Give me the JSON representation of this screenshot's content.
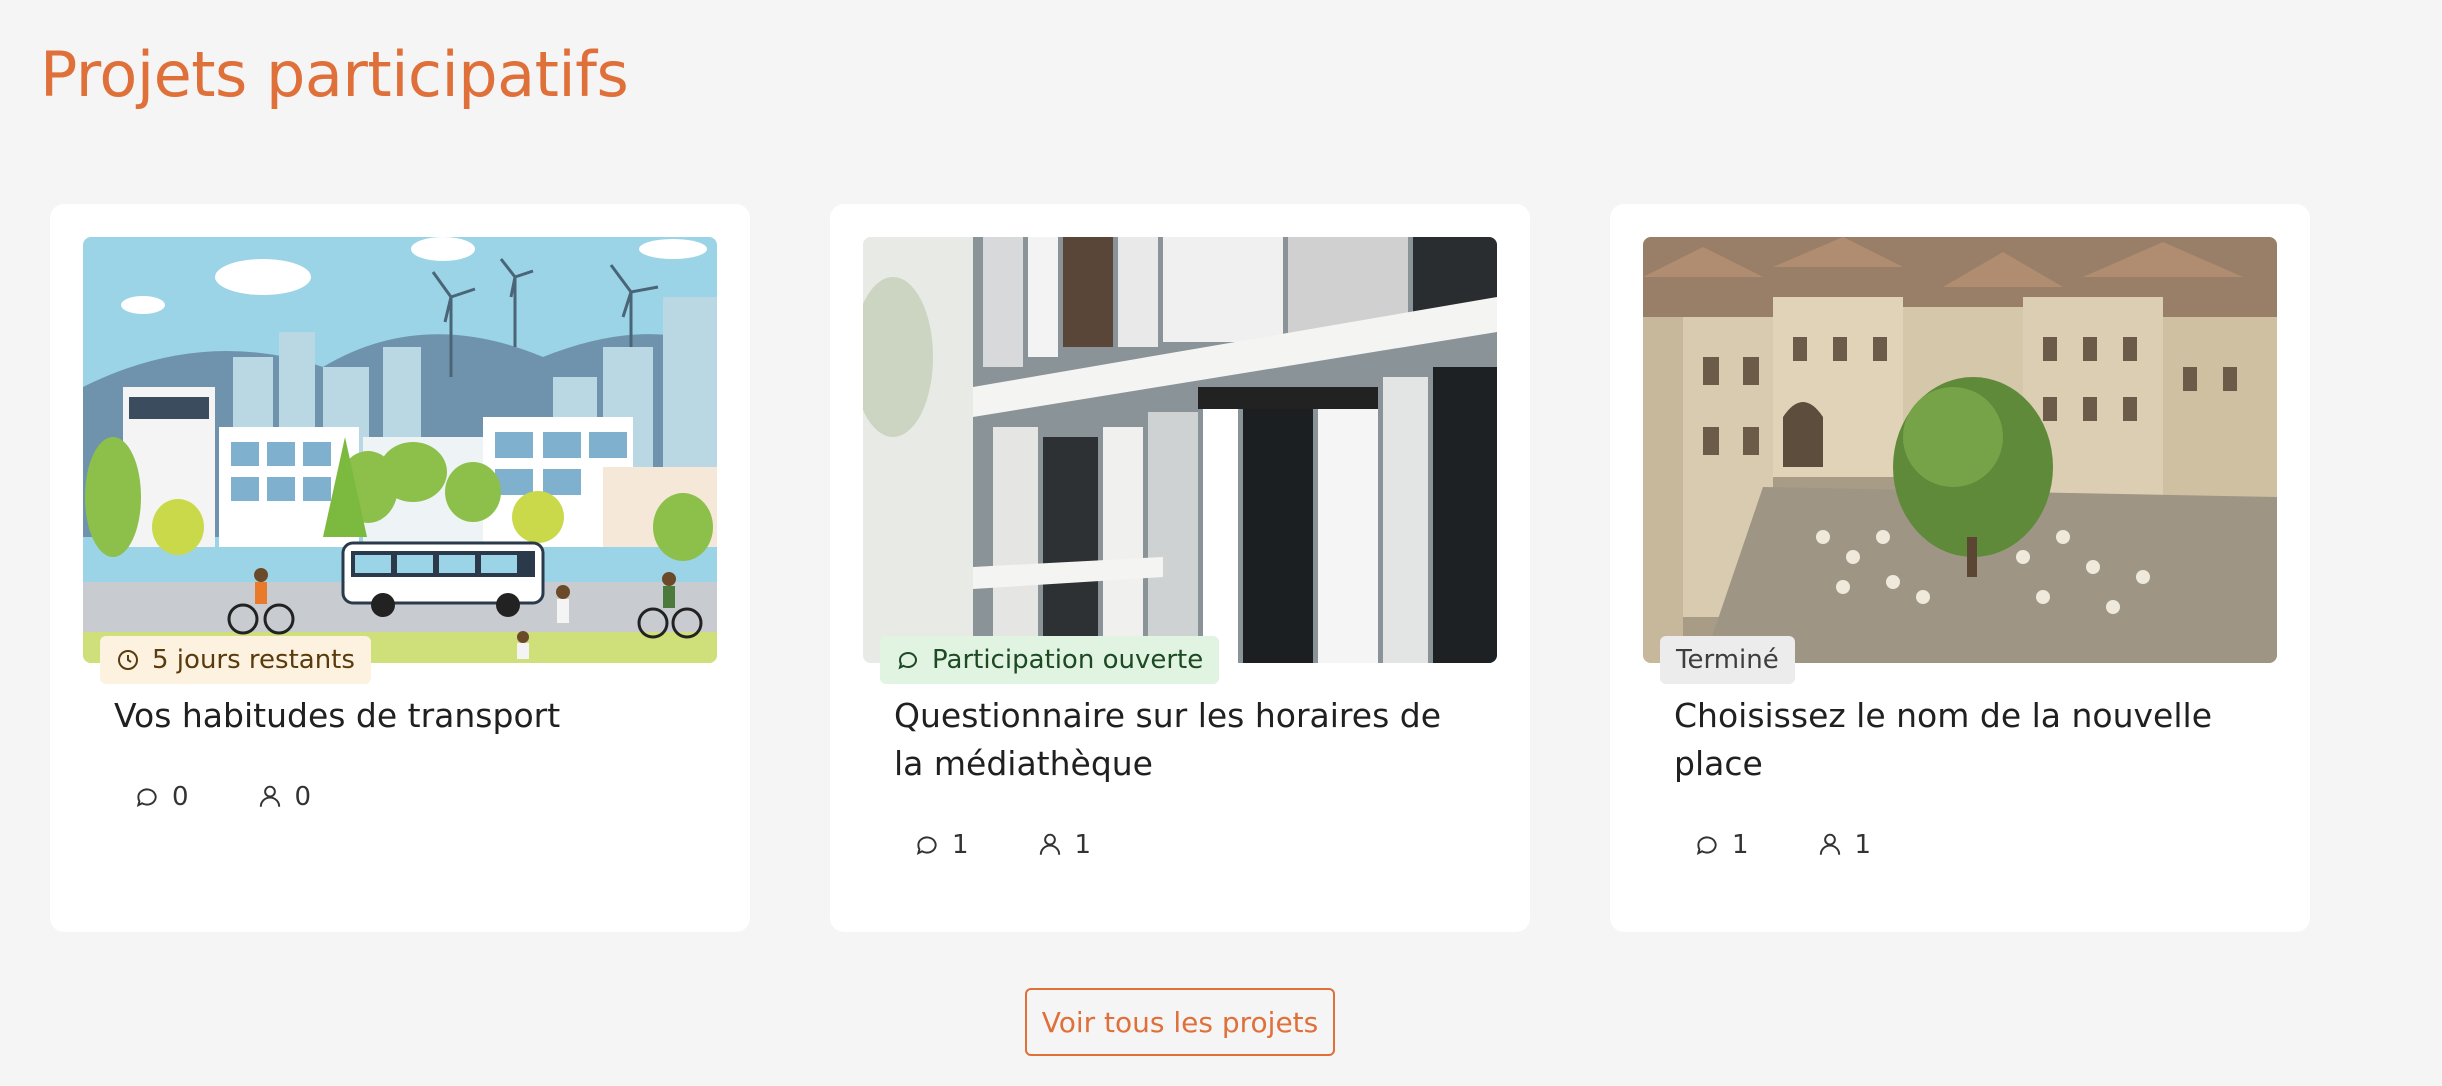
{
  "header": {
    "title": "Projets participatifs"
  },
  "colors": {
    "accent": "#e0703a",
    "badge_warn_bg": "#fdf2df",
    "badge_open_bg": "#e1f4e1",
    "badge_done_bg": "#ececec"
  },
  "projects": [
    {
      "title": "Vos habitudes de transport",
      "badge": {
        "label": "5 jours restants",
        "icon": "clock-icon"
      },
      "comments": "0",
      "participants": "0"
    },
    {
      "title": "Questionnaire sur les horaires de la médiathèque",
      "badge": {
        "label": "Participation ouverte",
        "icon": "speech-bubble-icon"
      },
      "comments": "1",
      "participants": "1"
    },
    {
      "title": "Choisissez le nom de la nouvelle place",
      "badge": {
        "label": "Terminé",
        "icon": ""
      },
      "comments": "1",
      "participants": "1"
    }
  ],
  "footer": {
    "view_all_label": "Voir tous les projets"
  }
}
